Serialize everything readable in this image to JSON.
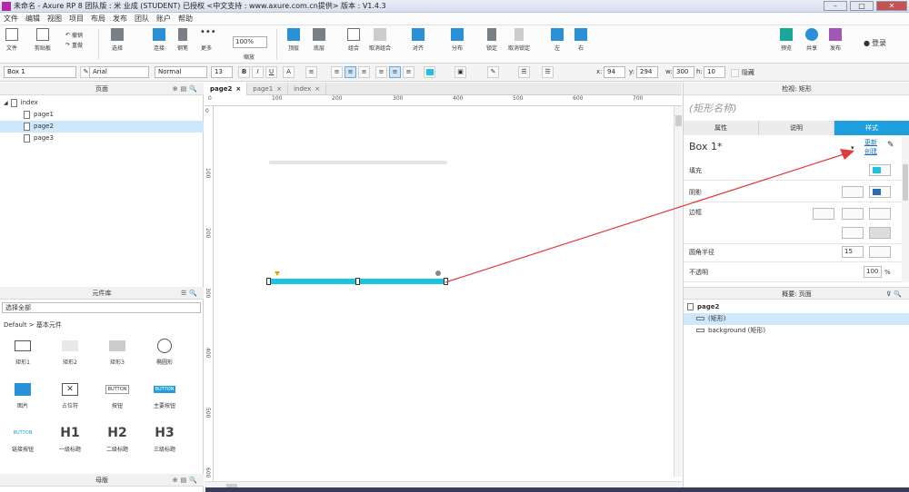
{
  "window": {
    "title": "未命名 - Axure RP 8 团队版 : 米 业成 (STUDENT) 已授权     <中文支持 : www.axure.com.cn提供> 版本 : V1.4.3"
  },
  "menu": [
    "文件",
    "编辑",
    "视图",
    "项目",
    "布局",
    "发布",
    "团队",
    "账户",
    "帮助"
  ],
  "toolbar": {
    "file": "文件",
    "clipboard": "剪贴板",
    "undo": "撤销",
    "redo": "重做",
    "select": "选择",
    "connect": "连接",
    "pen": "钢笔",
    "more": "更多",
    "zoom_value": "100%",
    "zoom_label": "缩放",
    "top": "顶层",
    "bottom": "底层",
    "group": "组合",
    "ungroup": "取消组合",
    "align": "对齐",
    "distribute": "分布",
    "lock": "锁定",
    "unlock": "取消锁定",
    "left": "左",
    "right": "右",
    "preview": "预览",
    "share": "共享",
    "publish": "发布",
    "login": "登录"
  },
  "format": {
    "widget_name": "Box 1",
    "font": "Arial",
    "style": "Normal",
    "size": "13",
    "x_label": "x:",
    "x": "94",
    "y_label": "y:",
    "y": "294",
    "w_label": "w:",
    "w": "300",
    "h_label": "h:",
    "h": "10",
    "hidden": "隐藏"
  },
  "pages": {
    "title": "页面",
    "root": "index",
    "items": [
      "page1",
      "page2",
      "page3"
    ],
    "selected_index": 1
  },
  "library": {
    "title": "元件库",
    "select": "选择全部",
    "group": "Default > 基本元件",
    "widgets": [
      "矩形1",
      "矩形2",
      "矩形3",
      "椭圆形",
      "图片",
      "占位符",
      "按钮",
      "主要按钮",
      "链接按钮",
      "一级标题",
      "二级标题",
      "三级标题"
    ],
    "button_text": "BUTTON",
    "h1": "H1",
    "h2": "H2",
    "h3": "H3"
  },
  "masters": {
    "title": "母版"
  },
  "tabs": [
    "page2",
    "page1",
    "index"
  ],
  "ruler": {
    "h": [
      "0",
      "100",
      "200",
      "300",
      "400",
      "500",
      "600",
      "700"
    ],
    "v": [
      "0",
      "100",
      "200",
      "300",
      "400",
      "500",
      "600"
    ]
  },
  "inspector": {
    "title": "检视: 矩形",
    "name_placeholder": "(矩形名称)",
    "tabs": [
      "属性",
      "说明",
      "样式"
    ],
    "style_name": "Box 1*",
    "update": "更新",
    "create": "创建",
    "fill": "填充",
    "shadow": "阴影",
    "border": "边框",
    "radius": "圆角半径",
    "radius_value": "15",
    "opacity": "不透明",
    "opacity_value": "100",
    "pct": "%"
  },
  "outline": {
    "title": "概要: 页面",
    "page": "page2",
    "items": [
      "(矩形)",
      "background (矩形)"
    ]
  },
  "colors": {
    "accent": "#1f9fdd",
    "bar": "#1cc3e0",
    "arrow": "#e03a3a"
  }
}
